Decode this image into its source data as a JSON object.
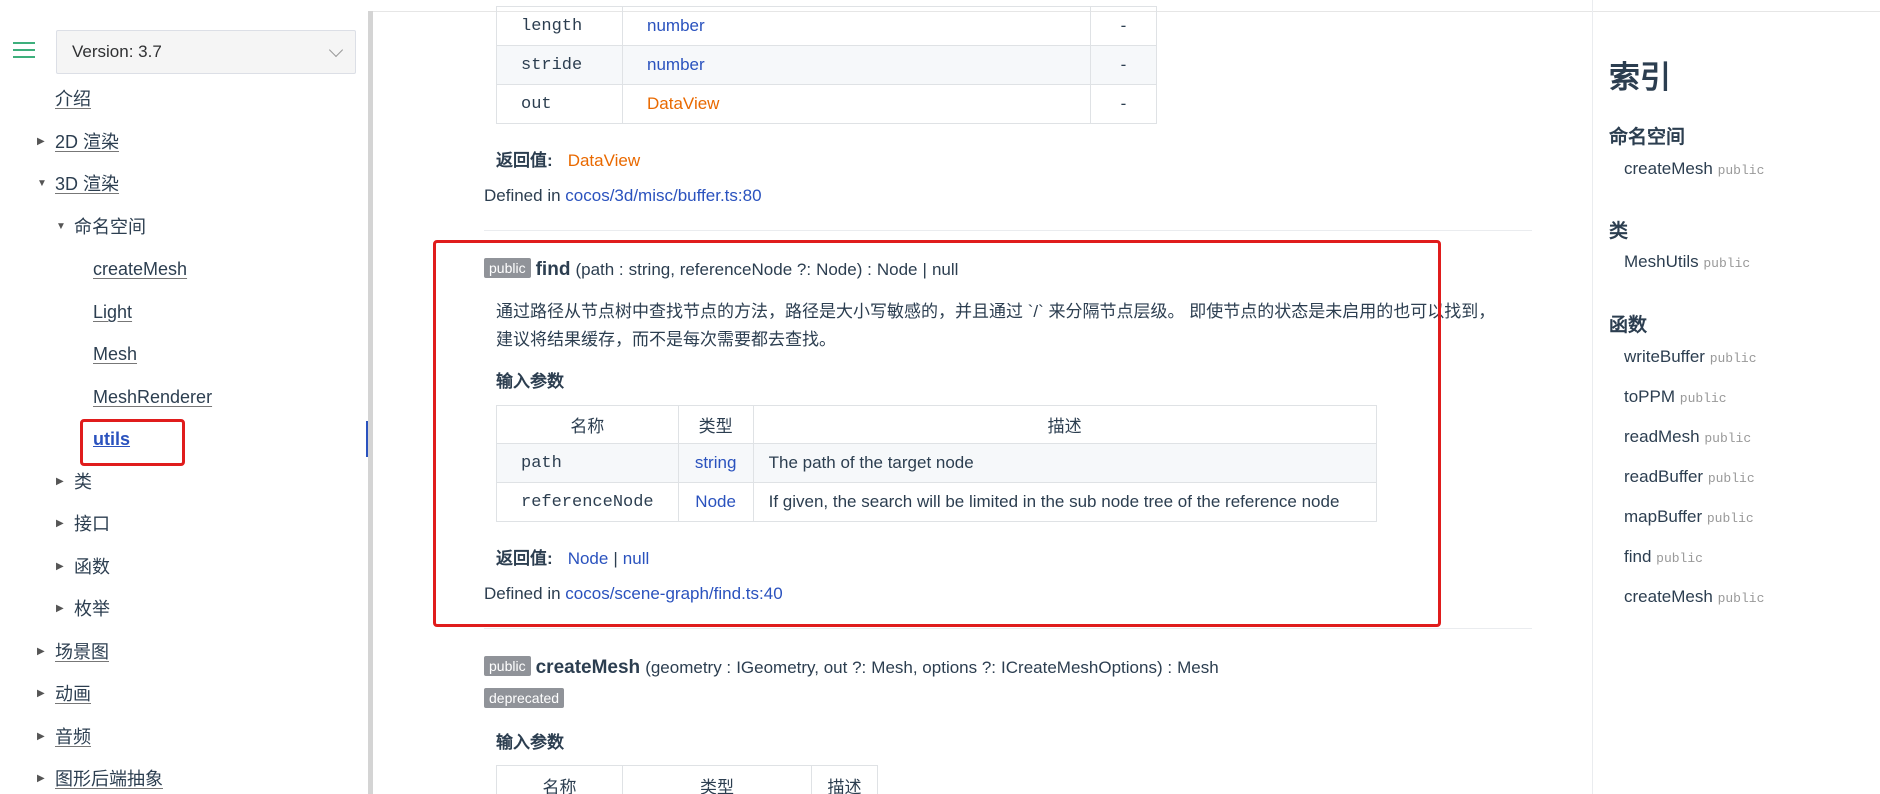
{
  "sidebar": {
    "version_label": "Version: 3.7",
    "items": [
      {
        "label": "介绍"
      },
      {
        "label": "2D 渲染"
      },
      {
        "label": "3D 渲染"
      },
      {
        "label": "命名空间"
      },
      {
        "label": "createMesh"
      },
      {
        "label": "Light"
      },
      {
        "label": "Mesh"
      },
      {
        "label": "MeshRenderer"
      },
      {
        "label": "utils"
      },
      {
        "label": "类"
      },
      {
        "label": "接口"
      },
      {
        "label": "函数"
      },
      {
        "label": "枚举"
      },
      {
        "label": "场景图"
      },
      {
        "label": "动画"
      },
      {
        "label": "音频"
      },
      {
        "label": "图形后端抽象"
      }
    ]
  },
  "prev": {
    "params": [
      {
        "name": "length",
        "type": "number",
        "desc": "-"
      },
      {
        "name": "stride",
        "type": "number",
        "desc": "-"
      },
      {
        "name": "out",
        "type": "DataView",
        "desc": "-"
      }
    ],
    "return_label": "返回值:",
    "return_type": "DataView",
    "defined_prefix": "Defined in",
    "defined_link": "cocos/3d/misc/buffer.ts:80"
  },
  "find": {
    "badge": "public",
    "name": "find",
    "sig_open": "(path :",
    "sig_path_type": "string",
    "sig_mid": ", referenceNode ?:",
    "sig_ref_type": "Node",
    "sig_close": ") :",
    "sig_ret1": "Node",
    "sig_pipe": "|",
    "sig_ret2": "null",
    "desc_line1": "通过路径从节点树中查找节点的方法，路径是大小写敏感的，并且通过 `/` 来分隔节点层级。 即使节点的状态是未启用的也可以找到，",
    "desc_line2": "建议将结果缓存，而不是每次需要都去查找。",
    "params_title": "输入参数",
    "headers": [
      "名称",
      "类型",
      "描述"
    ],
    "params": [
      {
        "name": "path",
        "type": "string",
        "desc": "The path of the target node"
      },
      {
        "name": "referenceNode",
        "type": "Node",
        "desc": "If given, the search will be limited in the sub node tree of the reference node"
      }
    ],
    "return_label": "返回值:",
    "return_type1": "Node",
    "return_pipe": "|",
    "return_type2": "null",
    "defined_prefix": "Defined in",
    "defined_link": "cocos/scene-graph/find.ts:40"
  },
  "createMesh": {
    "badge": "public",
    "name": "createMesh",
    "sig_open": "(geometry :",
    "sig_t1": "IGeometry",
    "sig_mid1": ", out ?:",
    "sig_t2": "Mesh",
    "sig_mid2": ", options ?:",
    "sig_t3": "ICreateMeshOptions",
    "sig_close": ") :",
    "sig_ret": "Mesh",
    "deprecated": "deprecated",
    "params_title": "输入参数",
    "headers": [
      "名称",
      "类型",
      "描述"
    ]
  },
  "index": {
    "title": "索引",
    "sections": [
      {
        "title": "命名空间",
        "items": [
          {
            "name": "createMesh",
            "tag": "public"
          }
        ]
      },
      {
        "title": "类",
        "items": [
          {
            "name": "MeshUtils",
            "tag": "public"
          }
        ]
      },
      {
        "title": "函数",
        "items": [
          {
            "name": "writeBuffer",
            "tag": "public"
          },
          {
            "name": "toPPM",
            "tag": "public"
          },
          {
            "name": "readMesh",
            "tag": "public"
          },
          {
            "name": "readBuffer",
            "tag": "public"
          },
          {
            "name": "mapBuffer",
            "tag": "public"
          },
          {
            "name": "find",
            "tag": "public"
          },
          {
            "name": "createMesh",
            "tag": "public"
          }
        ]
      }
    ]
  },
  "colors": {
    "accent": "#3eaf7c",
    "link": "#2a52be",
    "highlight": "#e01c1c",
    "type_orange": "#e96900"
  }
}
